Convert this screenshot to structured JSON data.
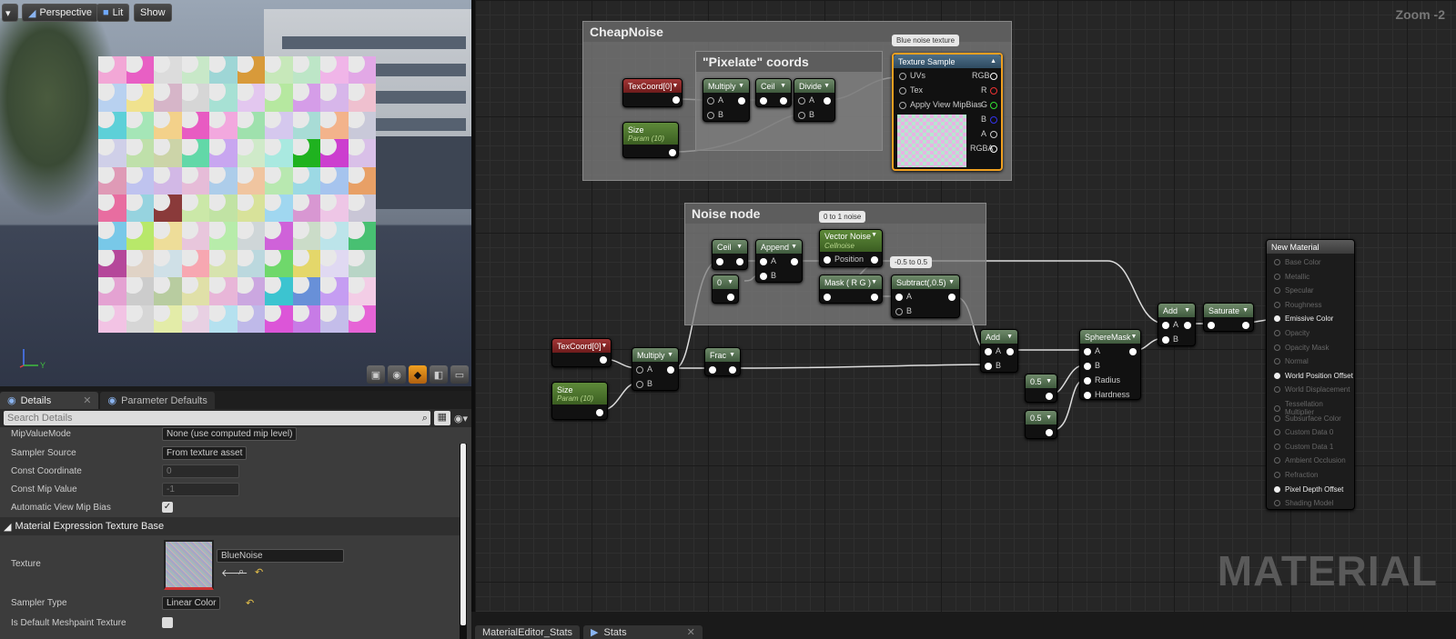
{
  "viewport": {
    "toolbar": {
      "menu_label": "▾",
      "perspective": "Perspective",
      "lit": "Lit",
      "show": "Show"
    },
    "tile_colors": [
      "#f2a7d6",
      "#e85fc4",
      "#dcdcdc",
      "#c8e8c8",
      "#9ed6d6",
      "#d89a3a",
      "#c7e8ba",
      "#bde6c7",
      "#f0b5e8",
      "#e2a8e6",
      "#b8d1f0",
      "#f0e28e",
      "#d6b5c8",
      "#d6d6d6",
      "#a7e1d4",
      "#e3c7ef",
      "#b6e8a0",
      "#d59de8",
      "#d7b6ea",
      "#efc0cf",
      "#5dd0d8",
      "#a5e6b7",
      "#f3d18a",
      "#e85bc2",
      "#f2a8de",
      "#9fe1ad",
      "#d5c8ee",
      "#a8dcd6",
      "#f3b38b",
      "#c9c9d9",
      "#cfcfe8",
      "#bfe0aa",
      "#ccd4a8",
      "#62d8a8",
      "#c8a6f0",
      "#cfeac9",
      "#a9e9e0",
      "#1fb21f",
      "#cc3ecf",
      "#d9c0e8",
      "#df9ab6",
      "#bfc3ef",
      "#d2b8e6",
      "#e6bcd8",
      "#adcdea",
      "#f0c5a0",
      "#b8e8b0",
      "#9cd9e4",
      "#a6c4ee",
      "#e8a066",
      "#e86da0",
      "#96d3df",
      "#8a3a3a",
      "#cbe8a8",
      "#c1e3a4",
      "#d8e29a",
      "#a0d7f0",
      "#d897d2",
      "#eec6e6",
      "#c9c6d6",
      "#78c8e8",
      "#b8e86a",
      "#eedd99",
      "#e8c6dc",
      "#b7ecaa",
      "#cfd6d8",
      "#cf62d9",
      "#cbdcc8",
      "#bce4ea",
      "#48c072",
      "#b5479a",
      "#e0d3c6",
      "#cfe0e7",
      "#f7a7b1",
      "#d7e3ae",
      "#bbd8de",
      "#6fd86b",
      "#e4d76a",
      "#e0d9f2",
      "#b8d5c6",
      "#e4a2d2",
      "#cccccc",
      "#b8cca0",
      "#e0e0a8",
      "#e8b6d8",
      "#cba7e0",
      "#3cc4d0",
      "#6890d8",
      "#c59df2",
      "#f3cde6",
      "#f2c3e4",
      "#d6d6d6",
      "#e3eca8",
      "#e8d0e3",
      "#b5e1ef",
      "#bfb9e9",
      "#dc55d8",
      "#c77be6",
      "#c4bdea",
      "#e664d6"
    ],
    "view_buttons": [
      "▣",
      "◉",
      "◆",
      "◧",
      "▭"
    ]
  },
  "details": {
    "tabs": [
      {
        "label": "Details",
        "close": "✕"
      },
      {
        "label": "Parameter Defaults",
        "close": ""
      }
    ],
    "search_placeholder": "Search Details",
    "rows": [
      {
        "label": "MipValueMode",
        "value": "None (use computed mip level)",
        "kind": "dropdown"
      },
      {
        "label": "Sampler Source",
        "value": "From texture asset",
        "kind": "dropdown"
      },
      {
        "label": "Const Coordinate",
        "value": "0",
        "kind": "number"
      },
      {
        "label": "Const Mip Value",
        "value": "-1",
        "kind": "number"
      },
      {
        "label": "Automatic View Mip Bias",
        "value": "✓",
        "kind": "check"
      }
    ],
    "category": "Material Expression Texture Base",
    "texture_label": "Texture",
    "texture_value": "BlueNoise",
    "sampler_type_label": "Sampler Type",
    "sampler_type_value": "Linear Color",
    "meshpaint_label": "Is Default Meshpaint Texture"
  },
  "graph": {
    "zoom": "Zoom -2",
    "watermark": "MATERIAL",
    "comments": {
      "cheap": "CheapNoise",
      "pixelate": "\"Pixelate\" coords",
      "noise": "Noise node"
    },
    "bubbles": {
      "blue": "Blue noise texture",
      "zero_one": "0 to 1 noise",
      "half": "-0.5 to 0.5"
    },
    "nodes": {
      "texcoord": "TexCoord[0]",
      "size": "Size",
      "size_sub": "Param (10)",
      "multiply": "Multiply",
      "ceil": "Ceil",
      "divide": "Divide",
      "texture_sample": "Texture Sample",
      "uvs": "UVs",
      "tex": "Tex",
      "mipbias": "Apply View MipBias",
      "rgb": "RGB",
      "r": "R",
      "g": "G",
      "b": "B",
      "a": "A",
      "rgba": "RGBA",
      "append": "Append",
      "zero": "0",
      "vector_noise": "Vector Noise",
      "vector_noise_sub": "Cellnoise",
      "position": "Position",
      "mask": "Mask ( R G )",
      "subtract": "Subtract(,0.5)",
      "frac": "Frac",
      "add": "Add",
      "spheremask": "SphereMask",
      "radius": "Radius",
      "hardness": "Hardness",
      "half1": "0.5",
      "half2": "0.5",
      "saturate": "Saturate",
      "pin_a": "A",
      "pin_b": "B"
    },
    "material": {
      "title": "New Material",
      "inputs": [
        {
          "label": "Base Color",
          "on": false
        },
        {
          "label": "Metallic",
          "on": false
        },
        {
          "label": "Specular",
          "on": false
        },
        {
          "label": "Roughness",
          "on": false
        },
        {
          "label": "Emissive Color",
          "on": true
        },
        {
          "label": "Opacity",
          "on": false
        },
        {
          "label": "Opacity Mask",
          "on": false
        },
        {
          "label": "Normal",
          "on": false
        },
        {
          "label": "World Position Offset",
          "on": true
        },
        {
          "label": "World Displacement",
          "on": false
        },
        {
          "label": "Tessellation Multiplier",
          "on": false
        },
        {
          "label": "Subsurface Color",
          "on": false
        },
        {
          "label": "Custom Data 0",
          "on": false
        },
        {
          "label": "Custom Data 1",
          "on": false
        },
        {
          "label": "Ambient Occlusion",
          "on": false
        },
        {
          "label": "Refraction",
          "on": false
        },
        {
          "label": "Pixel Depth Offset",
          "on": true
        },
        {
          "label": "Shading Model",
          "on": false
        }
      ]
    }
  },
  "bottom_tabs": [
    {
      "label": "MaterialEditor_Stats",
      "close": "✕"
    },
    {
      "label": "Stats",
      "close": "✕"
    }
  ]
}
